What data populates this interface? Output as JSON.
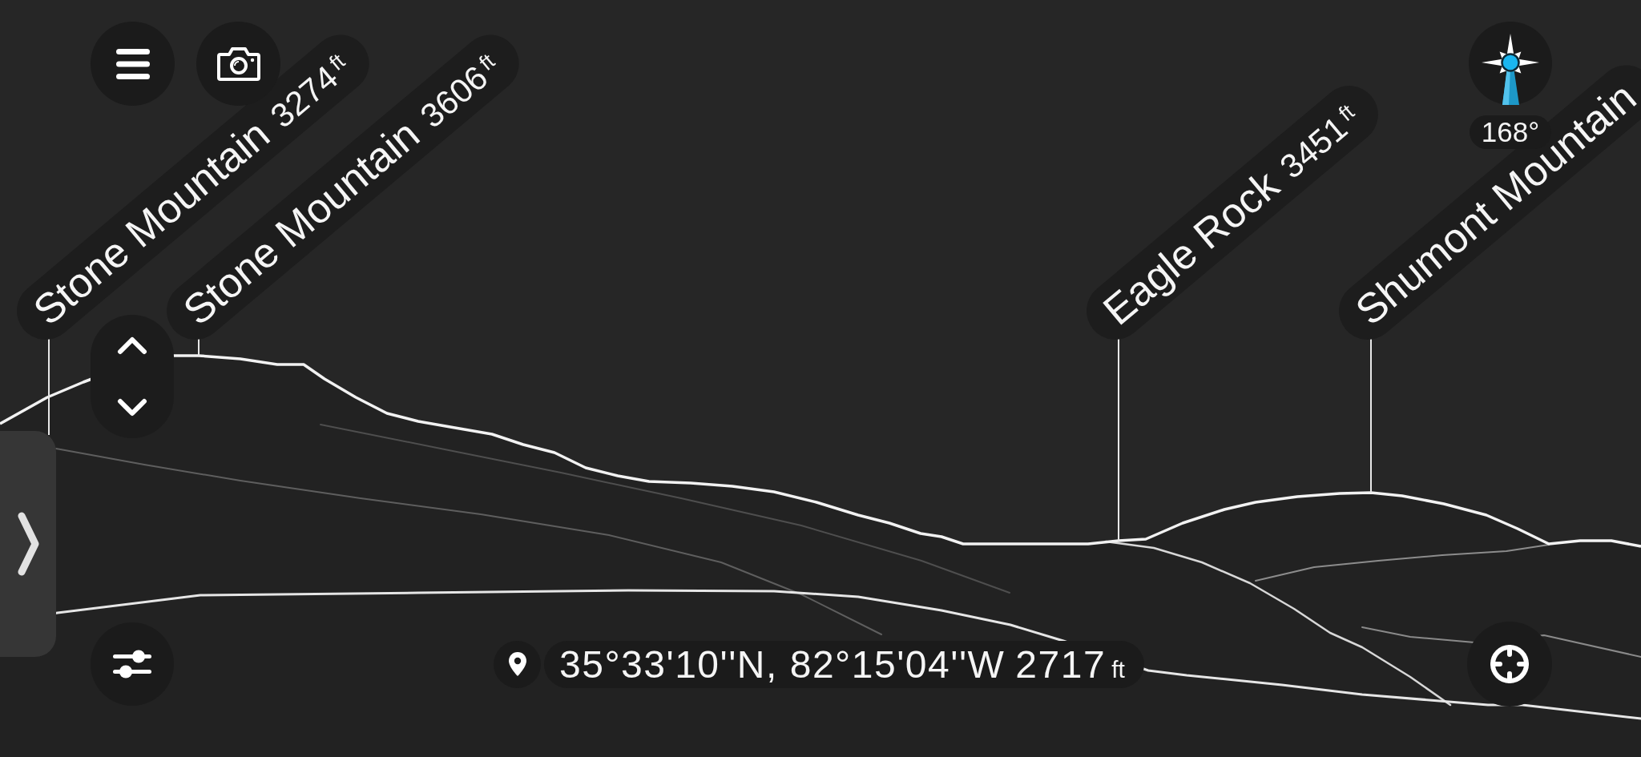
{
  "peak_labels": [
    {
      "name": "Stone Mountain",
      "elevation": "3274",
      "unit": "ft"
    },
    {
      "name": "Stone Mountain",
      "elevation": "3606",
      "unit": "ft"
    },
    {
      "name": "Eagle Rock",
      "elevation": "3451",
      "unit": "ft"
    },
    {
      "name": "Shumont Mountain"
    }
  ],
  "compass": {
    "heading": "168°"
  },
  "location": {
    "coordinates": "35°33'10''N, 82°15'04''W",
    "altitude": "2717",
    "unit": "ft"
  }
}
